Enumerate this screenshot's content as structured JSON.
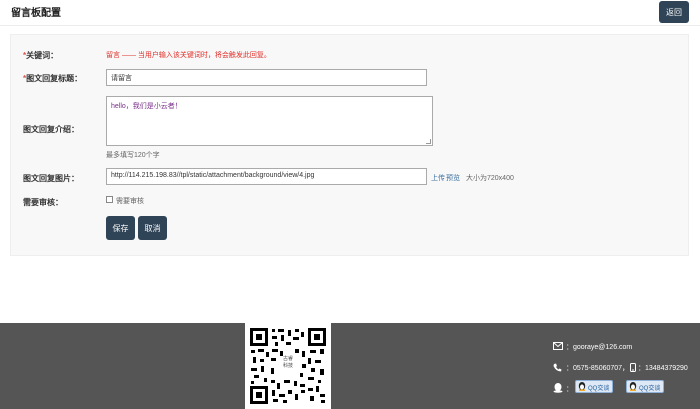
{
  "header": {
    "title": "留言板配置",
    "back_label": "返回"
  },
  "form": {
    "required_mark": "*",
    "keyword": {
      "label": "关键词：",
      "hint": "留言 —— 当用户输入该关键词时，将会触发此回复。"
    },
    "reply_title": {
      "label": "图文回复标题：",
      "value": "请留言"
    },
    "reply_intro": {
      "label": "图文回复介绍：",
      "value": "hello，我们是小云者！",
      "note": "最多填写120个字"
    },
    "reply_image": {
      "label": "图文回复图片：",
      "value": "http://114.215.198.83//tpl/static/attachment/background/view/4.jpg",
      "upload_label": "上传",
      "preview_label": "预览",
      "size_note": "大小为720x400"
    },
    "need_review": {
      "label": "需要审核：",
      "checkbox_label": "需要审核",
      "checked": false
    },
    "save_label": "保存",
    "cancel_label": "取消"
  },
  "footer": {
    "qr_caption": "古睿\n科技",
    "email": "：gooraye@126.com",
    "phone": "：0575-85060707，",
    "mobile": "：13484379290",
    "qq_sep": "：",
    "qq_buttons": [
      "QQ交谈",
      "QQ交谈"
    ]
  },
  "colors": {
    "button_bg": "#2f4457",
    "footer_bg": "#555555",
    "hint_red": "#e0302a",
    "required_red": "#d9534f"
  }
}
